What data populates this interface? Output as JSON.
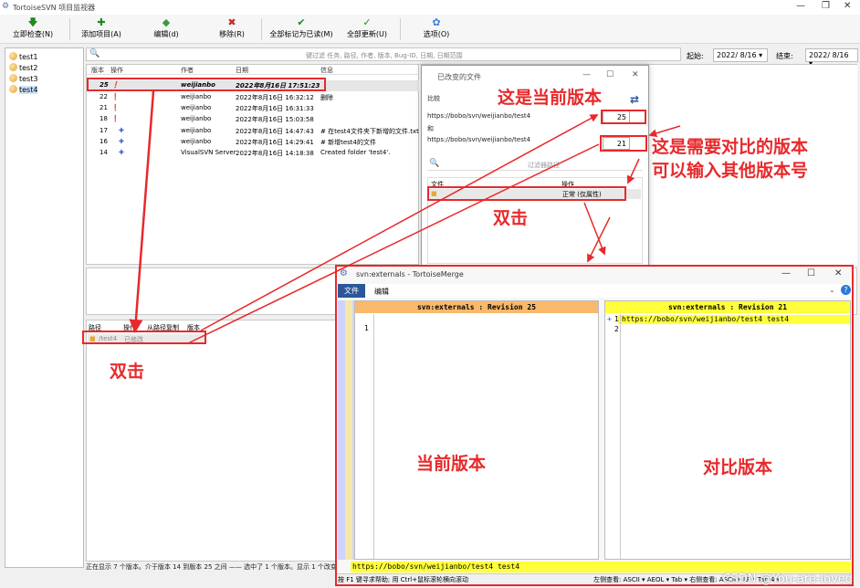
{
  "window": {
    "title": "TortoiseSVN 项目监视器"
  },
  "toolbar": [
    {
      "icon": "down-arrow-icon",
      "label": "立即检查(N)",
      "color": "#1f8a1f"
    },
    {
      "icon": "plus-icon",
      "label": "添加项目(A)",
      "color": "#1f8a1f"
    },
    {
      "icon": "diamond-icon",
      "label": "编辑(d)",
      "color": "#3c9a3c"
    },
    {
      "icon": "x-icon",
      "label": "移除(R)",
      "color": "#c62828"
    },
    {
      "icon": "check-icon",
      "label": "全部标记为已读(M)",
      "color": "#1f8a1f"
    },
    {
      "icon": "refresh-check-icon",
      "label": "全部更新(U)",
      "color": "#1f8a1f"
    },
    {
      "icon": "options-icon",
      "label": "选项(O)",
      "color": "#3c7bd8"
    }
  ],
  "tree": [
    "test1",
    "test2",
    "test3",
    "test4"
  ],
  "search": {
    "placeholder": "键过滤 任务, 路径, 作者, 版本, Bug-ID, 日期, 日期范围"
  },
  "dates": {
    "from_label": "起始:",
    "from": "2022/ 8/16",
    "to_label": "结束:",
    "to": "2022/ 8/16"
  },
  "log": {
    "headers": [
      "版本",
      "操作",
      "作者",
      "日期",
      "信息"
    ],
    "rows": [
      {
        "rev": "25",
        "author": "weijianbo",
        "date": "2022年8月16日 17:51:23",
        "msg": ""
      },
      {
        "rev": "22",
        "author": "weijianbo",
        "date": "2022年8月16日 16:32:12",
        "msg": "删除"
      },
      {
        "rev": "21",
        "author": "weijianbo",
        "date": "2022年8月16日 16:31:33",
        "msg": ""
      },
      {
        "rev": "18",
        "author": "weijianbo",
        "date": "2022年8月16日 15:03:58",
        "msg": ""
      },
      {
        "rev": "17",
        "author": "weijianbo",
        "date": "2022年8月16日 14:47:43",
        "msg": "# 在test4文件夹下新增的文件.txt"
      },
      {
        "rev": "16",
        "author": "weijianbo",
        "date": "2022年8月16日 14:29:41",
        "msg": "# 新增test4的文件"
      },
      {
        "rev": "14",
        "author": "VisualSVN Server",
        "date": "2022年8月16日 14:18:38",
        "msg": "Created folder 'test4'."
      }
    ]
  },
  "paths": {
    "headers": [
      "路径",
      "操作",
      "从路径复制",
      "版本"
    ],
    "row": {
      "path": "/test4",
      "action": "已修改"
    }
  },
  "status": "正在显示 7 个版本。介于版本 14 到版本 25 之间 —— 选中了 1 个版本。显示 1 个改变",
  "dialog": {
    "title": "已改变的文件",
    "compare": "比较",
    "url1": "https://bobo/svn/weijianbo/test4",
    "rev1": "25",
    "and": "和",
    "url2": "https://bobo/svn/weijianbo/test4",
    "rev2": "21",
    "filter": "过滤器路径",
    "col_file": "文件",
    "col_action": "操作",
    "file_action": "正常 (仅属性)"
  },
  "merge": {
    "title": "svn:externals - TortoiseMerge",
    "menu_file": "文件",
    "menu_edit": "编辑",
    "left_header": "svn:externals :  Revision 25",
    "right_header": "svn:externals :  Revision 21",
    "left_line": "1",
    "right_line1_no": "1",
    "right_line1": "https://bobo/svn/weijianbo/test4 test4",
    "right_line2_no": "2",
    "bottom": "https://bobo/svn/weijianbo/test4 test4",
    "status_left": "按 F1 键寻求帮助; 用 Ctrl+鼠标滚轮横向滚动",
    "status_right": "左侧查看:  ASCII ▾  AEOL ▾  Tab ▾     右侧查看:  ASCII ▾  LF ▾  Tab 4 ▾"
  },
  "annotations": {
    "current_version": "这是当前版本",
    "compare_version_1": "这是需要对比的版本",
    "compare_version_2": "可以输入其他版本号",
    "dblclick_1": "双击",
    "dblclick_2": "双击",
    "left_label": "当前版本",
    "right_label": "对比版本"
  },
  "watermark": "CSDN @You-are-loved",
  "colors": {
    "annotation": "#e8292b",
    "merge_left_header": "#f9b96b",
    "merge_right_header": "#ffff3b",
    "selection": "#2b579a"
  }
}
